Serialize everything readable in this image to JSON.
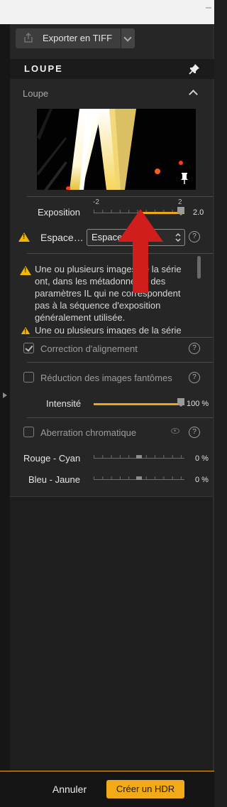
{
  "toolbar": {
    "export_label": "Exporter en TIFF",
    "export_icon": "share-icon",
    "dropdown_icon": "chevron-down-icon"
  },
  "loupe_panel": {
    "header_title": "LOUPE",
    "section_title": "Loupe",
    "pin_icon": "pin-icon",
    "collapse_icon": "chevron-up-icon"
  },
  "exposure": {
    "label": "Exposition",
    "min_label": "-2",
    "max_label": "2",
    "value": "2.0",
    "range": [
      -2,
      2
    ],
    "current": 2.0
  },
  "spacing": {
    "label": "Espace…",
    "selected": "Espacement IL",
    "help": "?"
  },
  "warnings": [
    "Une ou plusieurs images de la série ont, dans les métadonnées, des paramètres IL qui ne correspondent pas à la séquence d'exposition généralement utilisée.",
    "Une ou plusieurs images de la série"
  ],
  "options": {
    "alignment": {
      "label": "Correction d'alignement",
      "checked": true,
      "help": "?"
    },
    "ghost": {
      "label": "Réduction des images fantômes",
      "checked": false,
      "help": "?"
    },
    "intensity": {
      "label": "Intensité",
      "value": "100 %",
      "fraction": 1.0
    },
    "aberration": {
      "label": "Aberration chromatique",
      "checked": false,
      "help": "?",
      "eye_icon": "eye-icon"
    },
    "red_cyan": {
      "label": "Rouge - Cyan",
      "value": "0 %",
      "fraction": 0.5
    },
    "blue_yellow": {
      "label": "Bleu - Jaune",
      "value": "0 %",
      "fraction": 0.5
    }
  },
  "footer": {
    "cancel_label": "Annuler",
    "create_label": "Créer un HDR"
  },
  "colors": {
    "accent": "#f2aa18",
    "warning": "#f2b705",
    "annotation_arrow": "#d21d1d"
  }
}
